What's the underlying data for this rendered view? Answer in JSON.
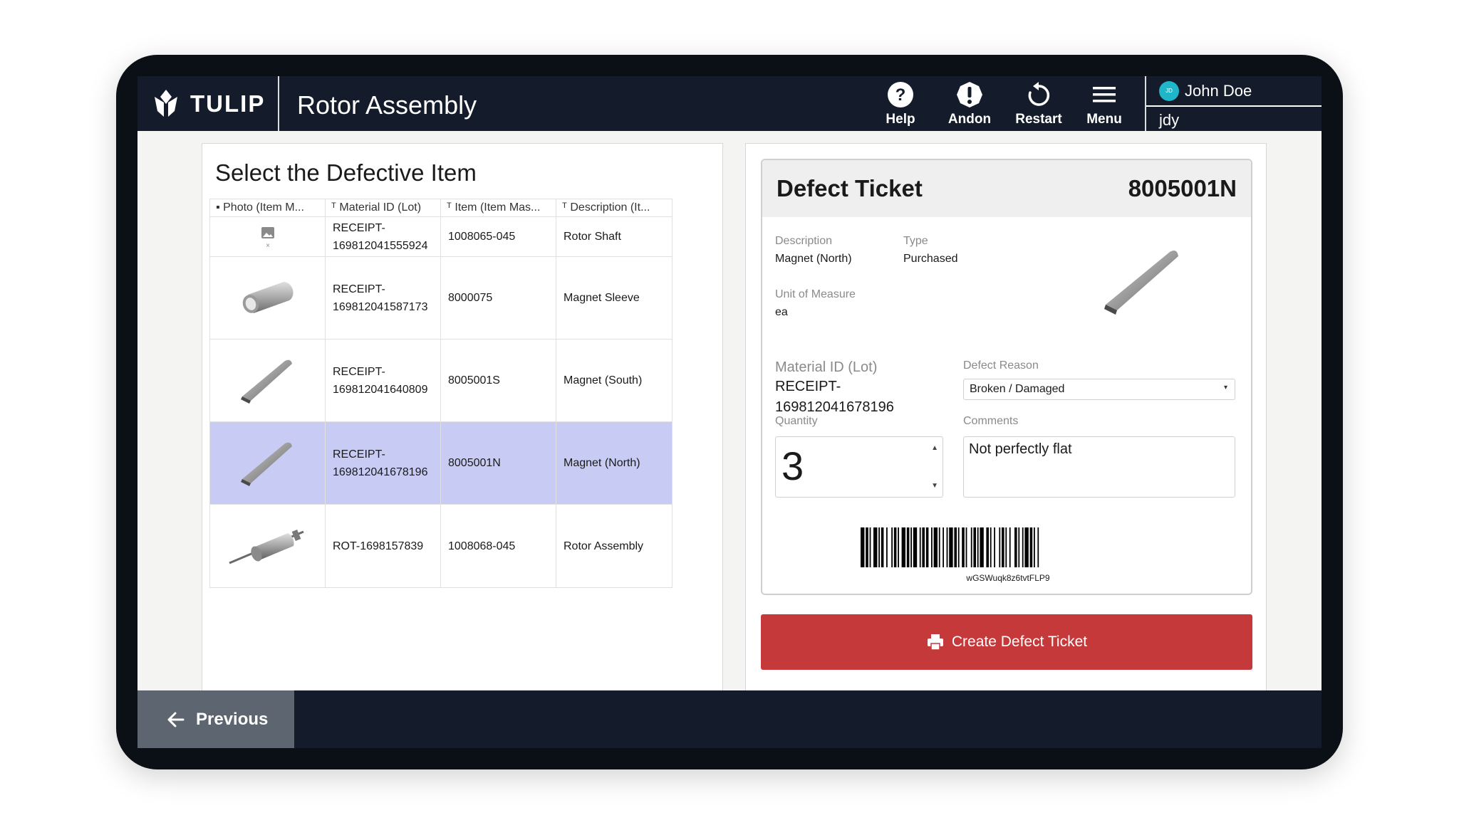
{
  "header": {
    "logo_text": "TULIP",
    "app_title": "Rotor Assembly",
    "nav": [
      {
        "label": "Help",
        "icon": "help-icon"
      },
      {
        "label": "Andon",
        "icon": "alert-icon"
      },
      {
        "label": "Restart",
        "icon": "restart-icon"
      },
      {
        "label": "Menu",
        "icon": "menu-icon"
      }
    ],
    "user": {
      "initials": "JD",
      "name": "John Doe",
      "id": "jdy"
    }
  },
  "left_panel": {
    "title": "Select the Defective Item",
    "columns": [
      "Photo (Item M...",
      "Material ID (Lot)",
      "Item (Item Mas...",
      "Description (It..."
    ],
    "rows": [
      {
        "material_id_1": "RECEIPT-",
        "material_id_2": "169812041555924",
        "item": "1008065-045",
        "description": "Rotor Shaft",
        "photo": "image-placeholder-icon"
      },
      {
        "material_id_1": "RECEIPT-",
        "material_id_2": "169812041587173",
        "item": "8000075",
        "description": "Magnet Sleeve",
        "photo": "sleeve-photo"
      },
      {
        "material_id_1": "RECEIPT-",
        "material_id_2": "169812041640809",
        "item": "8005001S",
        "description": "Magnet (South)",
        "photo": "magnet-photo"
      },
      {
        "material_id_1": "RECEIPT-",
        "material_id_2": "169812041678196",
        "item": "8005001N",
        "description": "Magnet (North)",
        "photo": "magnet-photo",
        "selected": true
      },
      {
        "material_id_1": "ROT-1698157839",
        "material_id_2": "",
        "item": "1008068-045",
        "description": "Rotor Assembly",
        "photo": "rotor-photo"
      }
    ]
  },
  "ticket": {
    "title": "Defect Ticket",
    "number": "8005001N",
    "description_label": "Description",
    "description_value": "Magnet (North)",
    "type_label": "Type",
    "type_value": "Purchased",
    "uom_label": "Unit of Measure",
    "uom_value": "ea",
    "material_label": "Material ID (Lot)",
    "material_value_1": "RECEIPT-",
    "material_value_2": "169812041678196",
    "quantity_label": "Quantity",
    "quantity_value": "3",
    "defect_reason_label": "Defect Reason",
    "defect_reason_value": "Broken / Damaged",
    "comments_label": "Comments",
    "comments_value": "Not perfectly flat",
    "barcode_text": "wGSWuqk8z6tvtFLP9"
  },
  "actions": {
    "create_label": "Create Defect Ticket",
    "previous_label": "Previous"
  },
  "colors": {
    "topbar": "#141c2b",
    "selected_row": "#c8ccf4",
    "create_button": "#c6393a",
    "previous_button": "#5d6570",
    "avatar": "#1fb6c9"
  }
}
